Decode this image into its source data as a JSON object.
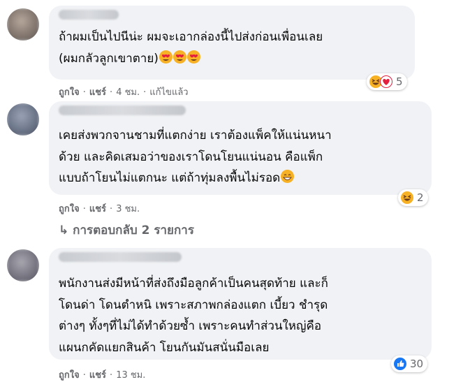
{
  "comments": [
    {
      "text": "ถ้าผมเป็นไปนีน่ะ ผมจะเอากล่องนี้ไปส่งก่อนเพื่อนเลย\n(ผมกลัวลูกเขาตาย)",
      "emojis": [
        "heart-eyes",
        "heart-eyes",
        "heart-eyes"
      ],
      "reactions": {
        "icons": [
          "haha-icon",
          "love-icon"
        ],
        "count": "5"
      },
      "actions": {
        "like": "ถูกใจ",
        "share": "แชร์",
        "time": "4 ชม.",
        "edited": "แก้ไขแล้ว"
      }
    },
    {
      "text": "เคยส่งพวกจานชามที่แตกง่าย เราต้องแพ็คให้แน่นหนา\nด้วย และคิดเสมอว่าของเราโดนโยนแน่นอน คือแพ็ก\nแบบถ้าโยนไม่แตกนะ แต่ถ้าทุ่มลงพื้นไม่รอด",
      "emojis": [
        "grin"
      ],
      "reactions": {
        "icons": [
          "haha-icon"
        ],
        "count": "2"
      },
      "actions": {
        "like": "ถูกใจ",
        "share": "แชร์",
        "time": "3 ชม."
      }
    },
    {
      "text": "พนักงานส่งมีหน้าที่ส่งถึงมือลูกค้าเป็นคนสุดท้าย และก็\nโดนด่า โดนตำหนิ เพราะสภาพกล่องแตก เบี้ยว ชำรุด\nต่างๆ ทั้งๆที่ไม่ได้ทำด้วยซ้ำ เพราะคนทำส่วนใหญ่คือ\nแผนกคัดแยกสินค้า โยนกันมันสนั่นมือเลย",
      "emojis": [],
      "reactions": {
        "icons": [
          "like-icon"
        ],
        "count": "30"
      },
      "actions": {
        "like": "ถูกใจ",
        "share": "แชร์",
        "time": "13 ชม."
      }
    }
  ],
  "replies_link": "↳ การตอบกลับ 2 รายการ",
  "colors": {
    "bubble": "#f0f2f5",
    "meta": "#65676b",
    "text": "#050505",
    "like_blue": "#1877f2"
  }
}
